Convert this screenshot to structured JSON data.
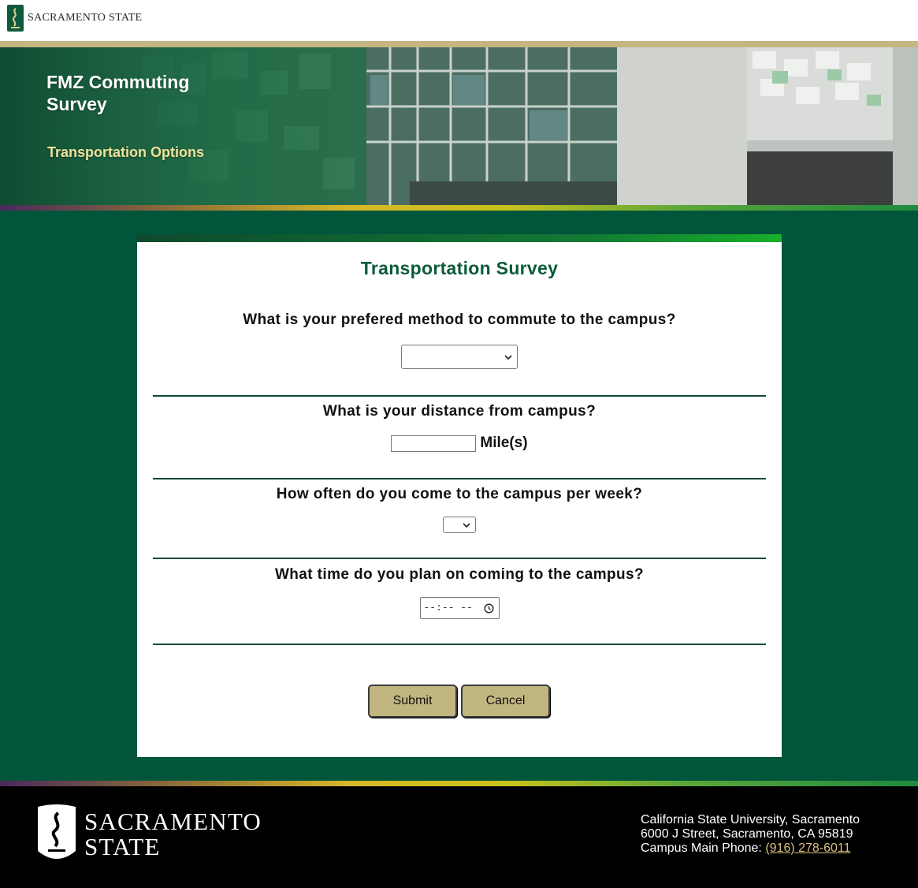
{
  "header": {
    "brand_text": "SACRAMENTO STATE"
  },
  "hero": {
    "title": "FMZ Commuting Survey",
    "subtitle": "Transportation Options"
  },
  "survey": {
    "title": "Transportation Survey",
    "questions": [
      {
        "label": "What is your prefered method to commute to the campus?",
        "control": "select",
        "value": ""
      },
      {
        "label": "What is your distance from campus?",
        "control": "text",
        "value": "",
        "unit": "Mile(s)"
      },
      {
        "label": "How often do you come to the campus per week?",
        "control": "select",
        "value": ""
      },
      {
        "label": "What time do you plan on coming to the campus?",
        "control": "time",
        "value": "--:-- --"
      }
    ],
    "buttons": {
      "submit": "Submit",
      "cancel": "Cancel"
    }
  },
  "footer": {
    "logo_line1": "SACRAMENTO",
    "logo_line2": "STATE",
    "address_line1": "California State University, Sacramento",
    "address_line2": "6000 J Street, Sacramento, CA 95819",
    "phone_label": "Campus Main Phone: ",
    "phone": "(916) 278-6011"
  },
  "colors": {
    "primary_green": "#00553a",
    "gold": "#c4b581",
    "button": "#c2b680",
    "subtitle_gold": "#f0e29a"
  }
}
